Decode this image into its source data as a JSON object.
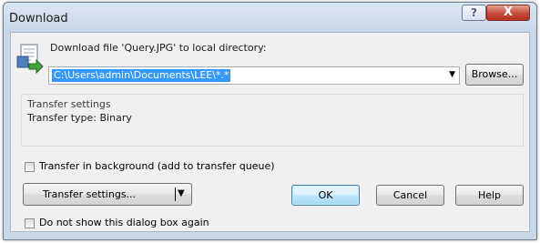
{
  "window": {
    "title": "Download",
    "help_button": "?",
    "close_button": "X"
  },
  "download": {
    "label": "Download file 'Query.JPG' to local directory:",
    "path": "C:\\Users\\admin\\Documents\\LEE\\*.*",
    "browse_label": "Browse..."
  },
  "transfer_settings": {
    "title": "Transfer settings",
    "type_text": "Transfer type: Binary"
  },
  "options": {
    "background_label": "Transfer in background (add to transfer queue)",
    "background_checked": false,
    "no_show_label": "Do not show this dialog box again",
    "no_show_checked": false
  },
  "buttons": {
    "transfer_settings": "Transfer settings...",
    "ok": "OK",
    "cancel": "Cancel",
    "help": "Help"
  },
  "colors": {
    "selection": "#3399ff",
    "frame": "#c9d7e6",
    "close": "#c6493a"
  }
}
